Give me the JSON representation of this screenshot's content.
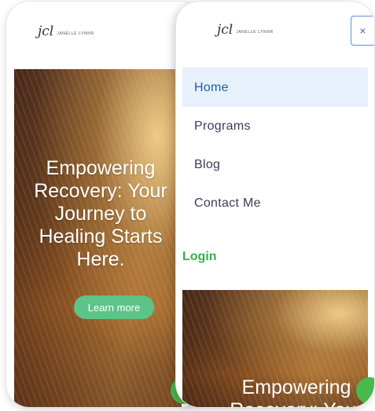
{
  "logo": {
    "mark": "jcl",
    "word": "JANELLE LYNNR"
  },
  "hero": {
    "title": "Empowering\nRecovery: Your\nJourney to\nHealing Starts\nHere.",
    "button_label": "Learn more",
    "title_partial": "Empowering\nRecovery: Your"
  },
  "menu": {
    "close_icon": "×",
    "items": [
      {
        "label": "Home",
        "active": true
      },
      {
        "label": "Programs",
        "active": false
      },
      {
        "label": "Blog",
        "active": false
      },
      {
        "label": "Contact Me",
        "active": false
      }
    ],
    "login_label": "Login"
  },
  "colors": {
    "accent_green": "#5dc489",
    "login_green": "#34b24a",
    "active_bg": "#e7f1fb",
    "active_text": "#1f5fa8",
    "chat_bubble": "#48b94f"
  }
}
